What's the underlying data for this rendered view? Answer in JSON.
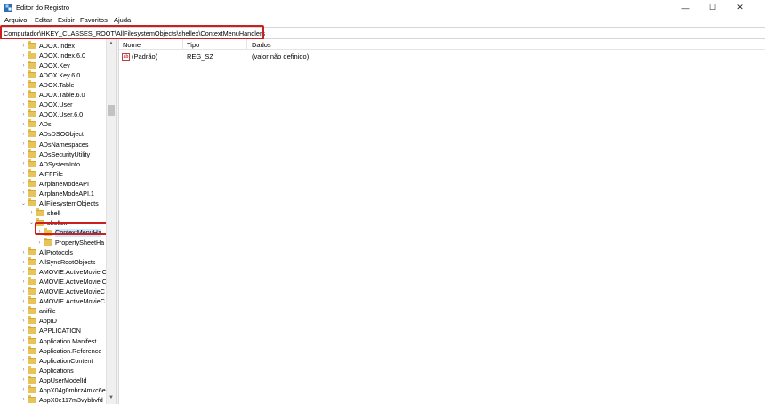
{
  "window": {
    "title": "Editor do Registro",
    "controls": {
      "minimize": "—",
      "maximize": "☐",
      "close": "✕"
    }
  },
  "menu": [
    "Arquivo",
    "Editar",
    "Exibir",
    "Favoritos",
    "Ajuda"
  ],
  "address": "Computador\\HKEY_CLASSES_ROOT\\AllFilesystemObjects\\shellex\\ContextMenuHandlers",
  "tree": {
    "items": [
      {
        "label": "ADOX.Index",
        "depth": 0,
        "expander": "›"
      },
      {
        "label": "ADOX.Index.6.0",
        "depth": 0,
        "expander": "›"
      },
      {
        "label": "ADOX.Key",
        "depth": 0,
        "expander": "›"
      },
      {
        "label": "ADOX.Key.6.0",
        "depth": 0,
        "expander": "›"
      },
      {
        "label": "ADOX.Table",
        "depth": 0,
        "expander": "›"
      },
      {
        "label": "ADOX.Table.6.0",
        "depth": 0,
        "expander": "›"
      },
      {
        "label": "ADOX.User",
        "depth": 0,
        "expander": "›"
      },
      {
        "label": "ADOX.User.6.0",
        "depth": 0,
        "expander": "›"
      },
      {
        "label": "ADs",
        "depth": 0,
        "expander": "›"
      },
      {
        "label": "ADsDSOObject",
        "depth": 0,
        "expander": "›"
      },
      {
        "label": "ADsNamespaces",
        "depth": 0,
        "expander": "›"
      },
      {
        "label": "ADsSecurityUtility",
        "depth": 0,
        "expander": "›"
      },
      {
        "label": "ADSystemInfo",
        "depth": 0,
        "expander": "›"
      },
      {
        "label": "AIFFFile",
        "depth": 0,
        "expander": "›"
      },
      {
        "label": "AirplaneModeAPI",
        "depth": 0,
        "expander": "›"
      },
      {
        "label": "AirplaneModeAPI.1",
        "depth": 0,
        "expander": "›"
      },
      {
        "label": "AllFilesystemObjects",
        "depth": 0,
        "expander": "⌄"
      },
      {
        "label": "shell",
        "depth": 1,
        "expander": "›"
      },
      {
        "label": "shellex",
        "depth": 1,
        "expander": "⌄"
      },
      {
        "label": "ContextMenuHa",
        "depth": 2,
        "expander": "›",
        "selected": true
      },
      {
        "label": "PropertySheetHa",
        "depth": 2,
        "expander": "›"
      },
      {
        "label": "AllProtocols",
        "depth": 0,
        "expander": "›"
      },
      {
        "label": "AllSyncRootObjects",
        "depth": 0,
        "expander": "›"
      },
      {
        "label": "AMOVIE.ActiveMovie C",
        "depth": 0,
        "expander": "›"
      },
      {
        "label": "AMOVIE.ActiveMovie C",
        "depth": 0,
        "expander": "›"
      },
      {
        "label": "AMOVIE.ActiveMovieC",
        "depth": 0,
        "expander": "›"
      },
      {
        "label": "AMOVIE.ActiveMovieC",
        "depth": 0,
        "expander": "›"
      },
      {
        "label": "anifile",
        "depth": 0,
        "expander": "›"
      },
      {
        "label": "AppID",
        "depth": 0,
        "expander": "›"
      },
      {
        "label": "APPLICATION",
        "depth": 0,
        "expander": "›"
      },
      {
        "label": "Application.Manifest",
        "depth": 0,
        "expander": "›"
      },
      {
        "label": "Application.Reference",
        "depth": 0,
        "expander": "›"
      },
      {
        "label": "ApplicationContent",
        "depth": 0,
        "expander": "›"
      },
      {
        "label": "Applications",
        "depth": 0,
        "expander": "›"
      },
      {
        "label": "AppUserModelId",
        "depth": 0,
        "expander": "›"
      },
      {
        "label": "AppX04g0mbrz4mkc6e",
        "depth": 0,
        "expander": "›"
      },
      {
        "label": "AppX0e117m3vybbvfd",
        "depth": 0,
        "expander": "›"
      }
    ]
  },
  "list": {
    "columns": [
      "Nome",
      "Tipo",
      "Dados"
    ],
    "rows": [
      {
        "icon": "ab",
        "name": "(Padrão)",
        "type": "REG_SZ",
        "data": "(valor não definido)"
      }
    ]
  },
  "colors": {
    "highlight": "#cc1f1f",
    "folder": "#e8c35a",
    "selection": "#cce8ff"
  }
}
